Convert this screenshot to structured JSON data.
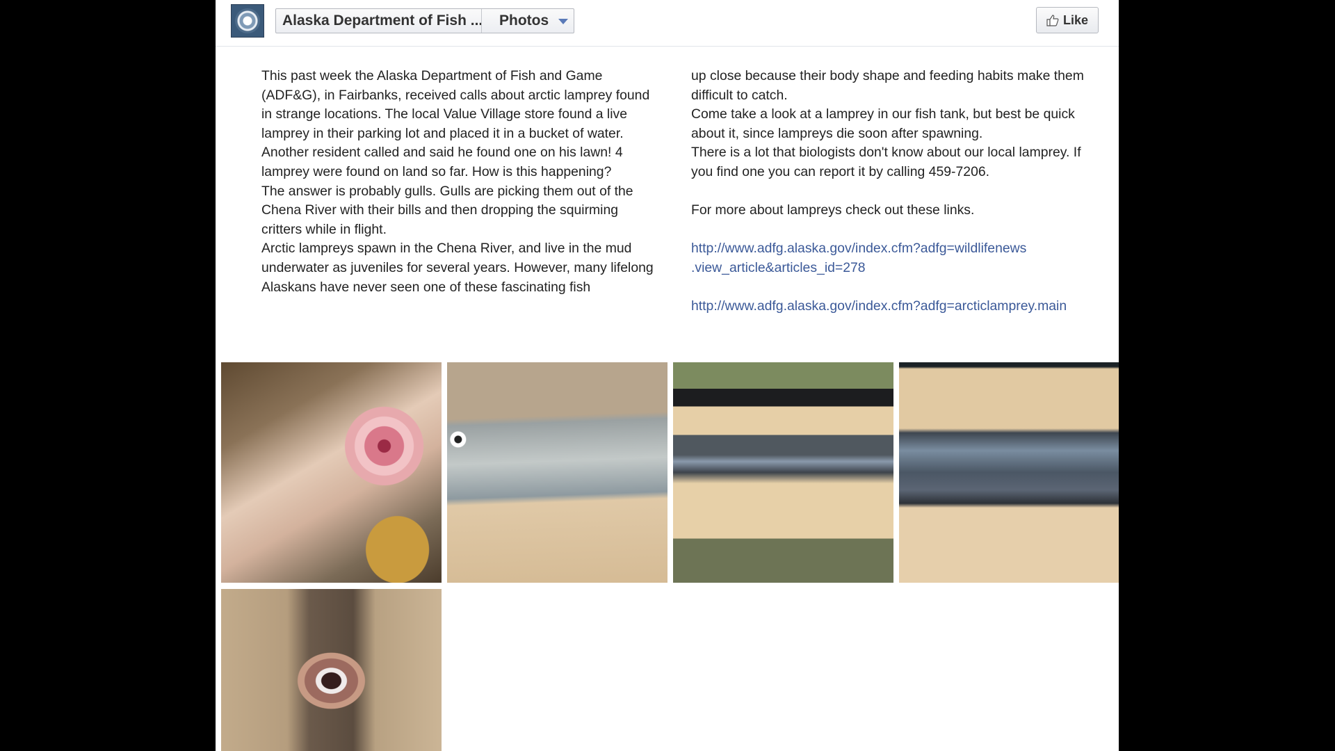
{
  "header": {
    "page_name": "Alaska Department of Fish ...",
    "section": "Photos",
    "like_label": "Like"
  },
  "post": {
    "left_paragraphs": [
      "This past week the Alaska Department of Fish and Game (ADF&G), in Fairbanks, received calls about arctic lamprey found in strange locations. The local Value Village store found a live lamprey in their parking lot and placed it in a bucket of water. Another resident called and said he found one on his lawn! 4 lamprey were found on land so far. How is this happening?",
      "The answer is probably gulls. Gulls are picking them out of the Chena River with their bills and then dropping the squirming critters while in flight.",
      "Arctic lampreys spawn in the Chena River, and live in the mud underwater as juveniles for several years. However, many lifelong Alaskans have never seen one of these fascinating fish"
    ],
    "right_paragraphs": [
      "up close because their body shape and feeding habits make them difficult to catch.",
      "Come take a look at a lamprey in our fish tank, but best be quick about it, since lampreys die soon after spawning.",
      "There is a lot that biologists don't know about our local lamprey. If you find one you can report it by calling 459-7206."
    ],
    "links_intro": "For more about lampreys check out these links.",
    "link1_line1": "http://www.adfg.alaska.gov/index.cfm?adfg=wildlifenews",
    "link1_line2": ".view_article&articles_id=278",
    "link2": "http://www.adfg.alaska.gov/index.cfm?adfg=arcticlamprey.main"
  },
  "photos": [
    {
      "subject": "lamprey-mouth-in-tank"
    },
    {
      "subject": "lamprey-gill-pores"
    },
    {
      "subject": "lamprey-on-board"
    },
    {
      "subject": "lamprey-body-closeup"
    },
    {
      "subject": "lamprey-mouth-on-board"
    }
  ],
  "colors": {
    "link": "#3b5998",
    "background": "#000000",
    "page": "#ffffff"
  }
}
